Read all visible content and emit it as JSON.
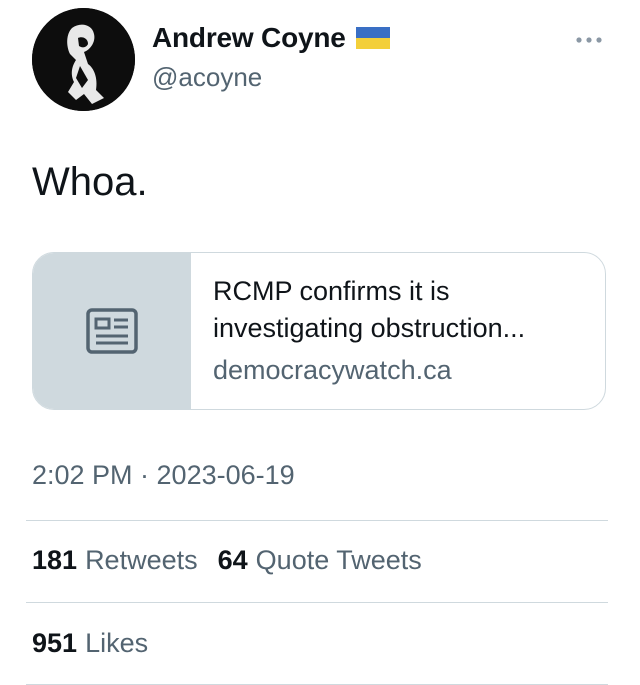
{
  "author": {
    "display_name": "Andrew Coyne",
    "handle": "@acoyne",
    "flag_emoji": "ukraine-flag-icon"
  },
  "tweet": {
    "text": "Whoa."
  },
  "link_card": {
    "title": "RCMP confirms it is investigating obstruction...",
    "domain": "democracywatch.ca",
    "icon": "news-article-icon"
  },
  "meta": {
    "timestamp": "2:02 PM · 2023-06-19"
  },
  "stats": {
    "retweets_count": "181",
    "retweets_label": "Retweets",
    "quotes_count": "64",
    "quotes_label": "Quote Tweets",
    "likes_count": "951",
    "likes_label": "Likes"
  },
  "colors": {
    "text_primary": "#0f1419",
    "text_secondary": "#536471",
    "border": "#cfd9de",
    "flag_blue": "#3a6fc4",
    "flag_yellow": "#f3cf3a"
  }
}
